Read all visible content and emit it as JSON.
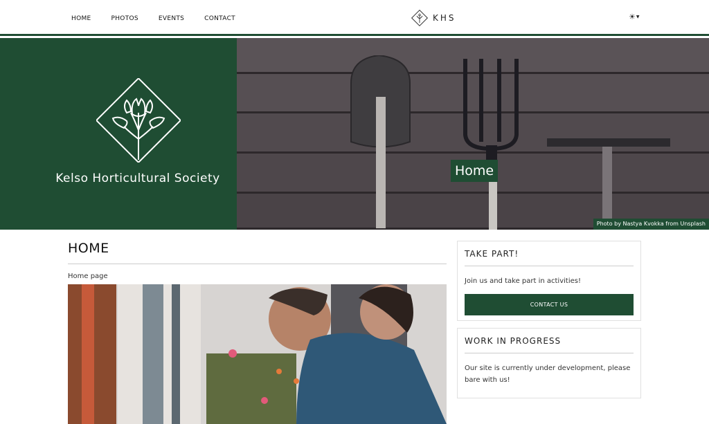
{
  "nav": {
    "links": [
      "HOME",
      "PHOTOS",
      "EVENTS",
      "CONTACT"
    ],
    "brand": "KHS",
    "theme_icon": "sun-icon"
  },
  "hero": {
    "society_name": "Kelso Horticultural Society",
    "title": "Home",
    "photo_credit": "Photo by Nastya Kvokka from Unsplash",
    "brand_color": "#1f4d33"
  },
  "main": {
    "heading": "HOME",
    "subtitle": "Home page"
  },
  "sidebar": {
    "take_part": {
      "title": "TAKE PART!",
      "text": "Join us and take part in activities!",
      "button": "CONTACT US"
    },
    "wip": {
      "title": "WORK IN PROGRESS",
      "text": "Our site is currently under development, please bare with us!"
    }
  }
}
